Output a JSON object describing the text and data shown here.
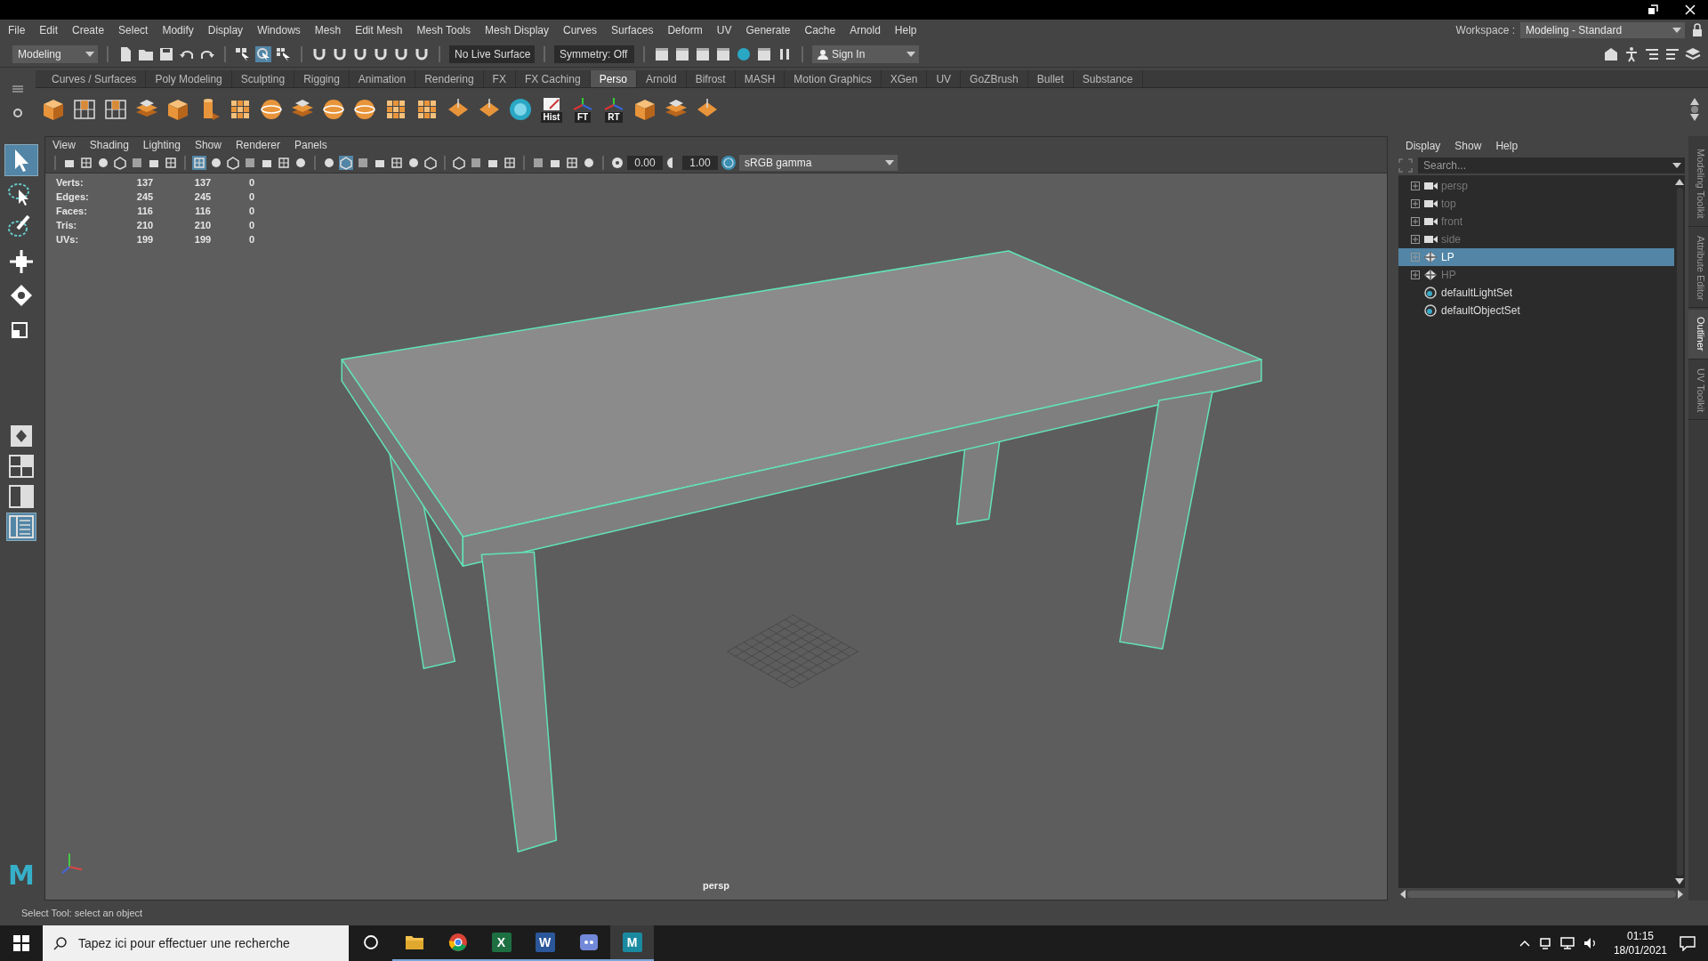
{
  "menu_bar": {
    "items": [
      "File",
      "Edit",
      "Create",
      "Select",
      "Modify",
      "Display",
      "Windows",
      "Mesh",
      "Edit Mesh",
      "Mesh Tools",
      "Mesh Display",
      "Curves",
      "Surfaces",
      "Deform",
      "UV",
      "Generate",
      "Cache",
      "Arnold",
      "Help"
    ],
    "workspace_label": "Workspace :",
    "workspace": "Modeling - Standard"
  },
  "status_line": {
    "mode": "Modeling",
    "select_tools": [
      {
        "kind": "hierarchy",
        "selected": false
      },
      {
        "kind": "object",
        "selected": true
      },
      {
        "kind": "component",
        "selected": false
      }
    ],
    "live_surface": "No Live Surface",
    "symmetry": "Symmetry: Off",
    "sign_in": "Sign In"
  },
  "shelf": {
    "tabs": [
      {
        "label": "Curves / Surfaces",
        "selected": false
      },
      {
        "label": "Poly Modeling",
        "selected": false
      },
      {
        "label": "Sculpting",
        "selected": false
      },
      {
        "label": "Rigging",
        "selected": false
      },
      {
        "label": "Animation",
        "selected": false
      },
      {
        "label": "Rendering",
        "selected": false
      },
      {
        "label": "FX",
        "selected": false
      },
      {
        "label": "FX Caching",
        "selected": false
      },
      {
        "label": "Perso",
        "selected": true
      },
      {
        "label": "Arnold",
        "selected": false
      },
      {
        "label": "Bifrost",
        "selected": false
      },
      {
        "label": "MASH",
        "selected": false
      },
      {
        "label": "Motion Graphics",
        "selected": false
      },
      {
        "label": "XGen",
        "selected": false
      },
      {
        "label": "UV",
        "selected": false
      },
      {
        "label": "GoZBrush",
        "selected": false
      },
      {
        "label": "Bullet",
        "selected": false
      },
      {
        "label": "Substance",
        "selected": false
      }
    ],
    "items": [
      {
        "kind": "cube"
      },
      {
        "kind": "grid"
      },
      {
        "kind": "grid"
      },
      {
        "kind": "layers"
      },
      {
        "kind": "cube"
      },
      {
        "kind": "cylinder"
      },
      {
        "kind": "tiles"
      },
      {
        "kind": "sphere"
      },
      {
        "kind": "layers"
      },
      {
        "kind": "sphere"
      },
      {
        "kind": "sphere"
      },
      {
        "kind": "tiles"
      },
      {
        "kind": "tiles"
      },
      {
        "kind": "diamond"
      },
      {
        "kind": "diamond"
      },
      {
        "kind": "disc"
      },
      {
        "kind": "note",
        "label": "Hist"
      },
      {
        "kind": "axes",
        "label": "FT"
      },
      {
        "kind": "axes",
        "label": "RT"
      },
      {
        "kind": "cube"
      },
      {
        "kind": "layers"
      },
      {
        "kind": "diamond"
      }
    ]
  },
  "toolbox": {
    "tools": [
      {
        "kind": "select",
        "selected": true
      },
      {
        "kind": "lasso",
        "selected": false
      },
      {
        "kind": "paint",
        "selected": false
      },
      {
        "kind": "move",
        "selected": false
      },
      {
        "kind": "rotate",
        "selected": false
      },
      {
        "kind": "scale",
        "selected": false
      }
    ],
    "layouts": [
      {
        "kind": "single",
        "selected": false
      },
      {
        "kind": "quad",
        "selected": false
      },
      {
        "kind": "split",
        "selected": false
      },
      {
        "kind": "outliner",
        "selected": true
      }
    ],
    "logo": "M"
  },
  "viewport": {
    "menu": [
      "View",
      "Shading",
      "Lighting",
      "Show",
      "Renderer",
      "Panels"
    ],
    "icon_groups": [
      {
        "icons": [
          {
            "selected": false
          },
          {
            "selected": false
          },
          {
            "selected": false
          },
          {
            "selected": false
          },
          {
            "selected": false
          },
          {
            "selected": false
          },
          {
            "selected": false
          }
        ]
      },
      {
        "icons": [
          {
            "selected": true
          },
          {
            "selected": false
          },
          {
            "selected": false
          },
          {
            "selected": false
          },
          {
            "selected": false
          },
          {
            "selected": false
          },
          {
            "selected": false
          }
        ]
      },
      {
        "icons": [
          {
            "selected": false
          },
          {
            "selected": true
          },
          {
            "selected": false
          },
          {
            "selected": false
          },
          {
            "selected": false
          },
          {
            "selected": false
          },
          {
            "selected": false
          }
        ]
      },
      {
        "icons": [
          {
            "selected": false
          },
          {
            "selected": false
          },
          {
            "selected": false
          },
          {
            "selected": false
          }
        ]
      },
      {
        "icons": [
          {
            "selected": false
          },
          {
            "selected": false
          },
          {
            "selected": false
          },
          {
            "selected": false
          }
        ]
      }
    ],
    "exposure": "0.00",
    "gamma": "1.00",
    "color_space": "sRGB gamma",
    "hud": [
      {
        "label": "Verts:",
        "values": [
          "137",
          "137",
          "0"
        ]
      },
      {
        "label": "Edges:",
        "values": [
          "245",
          "245",
          "0"
        ]
      },
      {
        "label": "Faces:",
        "values": [
          "116",
          "116",
          "0"
        ]
      },
      {
        "label": "Tris:",
        "values": [
          "210",
          "210",
          "0"
        ]
      },
      {
        "label": "UVs:",
        "values": [
          "199",
          "199",
          "0"
        ]
      }
    ],
    "camera": "persp"
  },
  "outliner": {
    "menu": [
      "Display",
      "Show",
      "Help"
    ],
    "search": {
      "placeholder": "Search..."
    },
    "items": [
      {
        "label": "persp",
        "kind": "camera",
        "expandable": true,
        "hidden": true,
        "selected": false
      },
      {
        "label": "top",
        "kind": "camera",
        "expandable": true,
        "hidden": true,
        "selected": false
      },
      {
        "label": "front",
        "kind": "camera",
        "expandable": true,
        "hidden": true,
        "selected": false
      },
      {
        "label": "side",
        "kind": "camera",
        "expandable": true,
        "hidden": true,
        "selected": false
      },
      {
        "label": "LP",
        "kind": "group",
        "expandable": true,
        "hidden": false,
        "selected": true
      },
      {
        "label": "HP",
        "kind": "group",
        "expandable": true,
        "hidden": true,
        "selected": false
      },
      {
        "label": "defaultLightSet",
        "kind": "set",
        "expandable": false,
        "hidden": false,
        "selected": false
      },
      {
        "label": "defaultObjectSet",
        "kind": "set",
        "expandable": false,
        "hidden": false,
        "selected": false
      }
    ]
  },
  "side_tabs": [
    {
      "label": "Modeling Toolkit",
      "selected": false
    },
    {
      "label": "Attribute Editor",
      "selected": false
    },
    {
      "label": "Outliner",
      "selected": true
    },
    {
      "label": "UV Toolkit",
      "selected": false
    }
  ],
  "help_line": "Select Tool: select an object",
  "taskbar": {
    "search": {
      "placeholder": "Tapez ici pour effectuer une recherche"
    },
    "apps": [
      {
        "kind": "task-view",
        "running": false,
        "selected": false
      },
      {
        "kind": "folder",
        "running": true,
        "selected": false
      },
      {
        "kind": "chrome",
        "running": true,
        "selected": false
      },
      {
        "kind": "excel",
        "label": "X",
        "running": true,
        "selected": false
      },
      {
        "kind": "word",
        "label": "W",
        "running": true,
        "selected": false
      },
      {
        "kind": "discord",
        "running": true,
        "selected": false
      },
      {
        "kind": "maya",
        "label": "M",
        "running": true,
        "selected": true
      }
    ],
    "time": "01:15",
    "date": "18/01/2021"
  }
}
